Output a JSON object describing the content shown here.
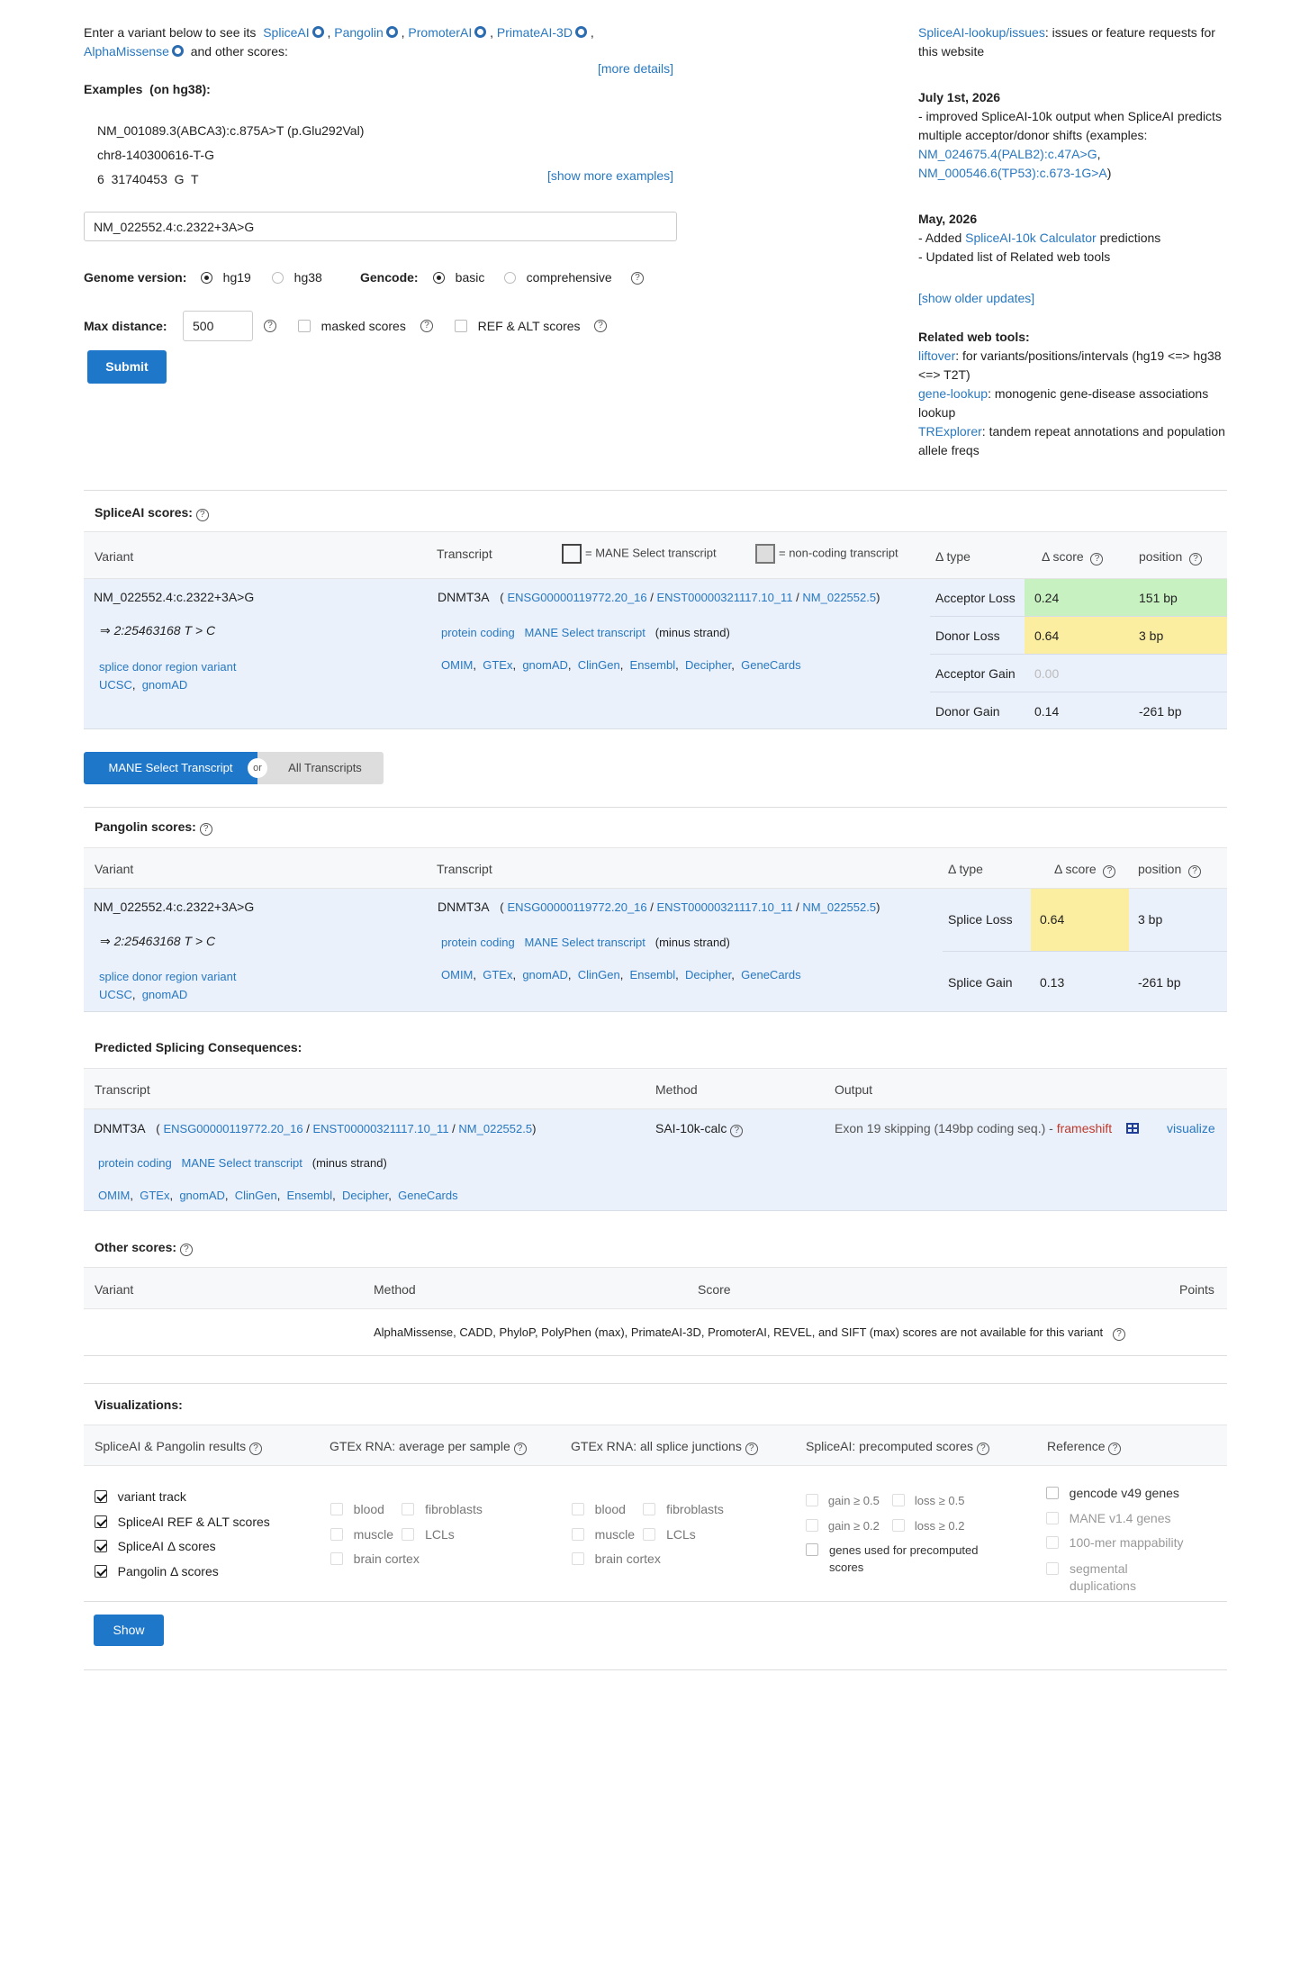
{
  "intro": {
    "prefix": "Enter a variant below to see its",
    "tools": [
      "SpliceAI",
      "Pangolin",
      "PromoterAI",
      "PrimateAI-3D",
      "AlphaMissense"
    ],
    "suffix": "and other scores:",
    "more_details": "[more details]"
  },
  "examples": {
    "label": "Examples",
    "genome": "(on hg38):",
    "items": [
      "NM_001089.3(ABCA3):c.875A>T (p.Glu292Val)",
      "chr8-140300616-T-G",
      "6  31740453  G  T"
    ],
    "show_more": "[show more examples]"
  },
  "search": {
    "value": "NM_022552.4:c.2322+3A>G"
  },
  "options": {
    "genome_label": "Genome version:",
    "genome_opts": [
      "hg19",
      "hg38"
    ],
    "gencode_label": "Gencode:",
    "gencode_opts": [
      "basic",
      "comprehensive"
    ],
    "maxdist_label": "Max distance:",
    "maxdist_value": "500",
    "masked": "masked scores",
    "refalt": "REF & ALT scores",
    "submit": "Submit"
  },
  "sidebar": {
    "issues_link": "SpliceAI-lookup/issues",
    "issues_text": ": issues or feature requests for this website",
    "u1_date": "July 1st, 2026",
    "u1_text": "- improved SpliceAI-10k output when SpliceAI predicts multiple acceptor/donor shifts (examples:",
    "u1_ex1": "NM_024675.4(PALB2):c.47A>G",
    "u1_ex2": "NM_000546.6(TP53):c.673-1G>A",
    "u1_close": ")",
    "u2_date": "May, 2026",
    "u2_prefix": "- Added",
    "u2_link": "SpliceAI-10k Calculator",
    "u2_suffix": "predictions",
    "u2_line2": "- Updated list of Related web tools",
    "older": "[show older updates]",
    "related_title": "Related web tools:",
    "tools": [
      {
        "name": "liftover",
        "desc": ": for variants/positions/intervals (hg19 <=> hg38 <=> T2T)"
      },
      {
        "name": "gene-lookup",
        "desc": ": monogenic gene-disease associations lookup"
      },
      {
        "name": "TRExplorer",
        "desc": ": tandem repeat annotations and population allele freqs"
      }
    ]
  },
  "common": {
    "variant": "NM_022552.4:c.2322+3A>G",
    "arrow": "⇒ 2:25463168 T > C",
    "consequence": "splice donor region variant",
    "ucsc": "UCSC",
    "gnomad": "gnomAD",
    "gene": "DNMT3A",
    "ensg": "ENSG00000119772.20_16",
    "enst": "ENST00000321117.10_11",
    "nm": "NM_022552.5",
    "biotype": "protein coding",
    "mane": "MANE Select transcript",
    "strand": "(minus strand)",
    "links": [
      "OMIM",
      "GTEx",
      "gnomAD",
      "ClinGen",
      "Ensembl",
      "Decipher",
      "GeneCards"
    ]
  },
  "spliceai": {
    "title": "SpliceAI scores:",
    "col_variant": "Variant",
    "col_transcript": "Transcript",
    "legend_mane": "= MANE Select transcript",
    "legend_noncoding": "= non-coding transcript",
    "col_type": "Δ type",
    "col_score": "Δ score",
    "col_pos": "position",
    "rows": [
      {
        "type": "Acceptor Loss",
        "score": "0.24",
        "pos": "151 bp"
      },
      {
        "type": "Donor Loss",
        "score": "0.64",
        "pos": "3 bp"
      },
      {
        "type": "Acceptor Gain",
        "score": "0.00",
        "pos": ""
      },
      {
        "type": "Donor Gain",
        "score": "0.14",
        "pos": "-261 bp"
      }
    ]
  },
  "toggle": {
    "mane": "MANE Select Transcript",
    "or": "or",
    "all": "All Transcripts"
  },
  "pangolin": {
    "title": "Pangolin scores:",
    "rows": [
      {
        "type": "Splice Loss",
        "score": "0.64",
        "pos": "3 bp"
      },
      {
        "type": "Splice Gain",
        "score": "0.13",
        "pos": "-261 bp"
      }
    ]
  },
  "consequences": {
    "title": "Predicted Splicing Consequences:",
    "col_transcript": "Transcript",
    "col_method": "Method",
    "col_output": "Output",
    "method": "SAI-10k-calc",
    "output": "Exon 19 skipping (149bp coding seq.) -",
    "effect": "frameshift",
    "visualize": "visualize"
  },
  "other": {
    "title": "Other scores:",
    "col_variant": "Variant",
    "col_method": "Method",
    "col_score": "Score",
    "col_points": "Points",
    "message": "AlphaMissense,  CADD,  PhyloP,  PolyPhen (max),  PrimateAI-3D,  PromoterAI,  REVEL,  and SIFT (max) scores are not available for this variant"
  },
  "viz": {
    "title": "Visualizations:",
    "col1": "SpliceAI & Pangolin results",
    "col2": "GTEx RNA: average per sample",
    "col3": "GTEx RNA: all splice junctions",
    "col4": "SpliceAI: precomputed scores",
    "col5": "Reference",
    "c1": [
      "variant track",
      "SpliceAI REF & ALT scores",
      "SpliceAI Δ  scores",
      "Pangolin Δ  scores"
    ],
    "tissues": [
      "blood",
      "fibroblasts",
      "muscle",
      "LCLs",
      "brain cortex"
    ],
    "c4": [
      "gain ≥ 0.5",
      "loss ≥ 0.5",
      "gain ≥ 0.2",
      "loss ≥ 0.2",
      "genes used for precomputed scores"
    ],
    "c5": [
      "gencode v49 genes",
      "MANE v1.4 genes",
      "100-mer mappability",
      "segmental duplications"
    ],
    "show": "Show"
  }
}
